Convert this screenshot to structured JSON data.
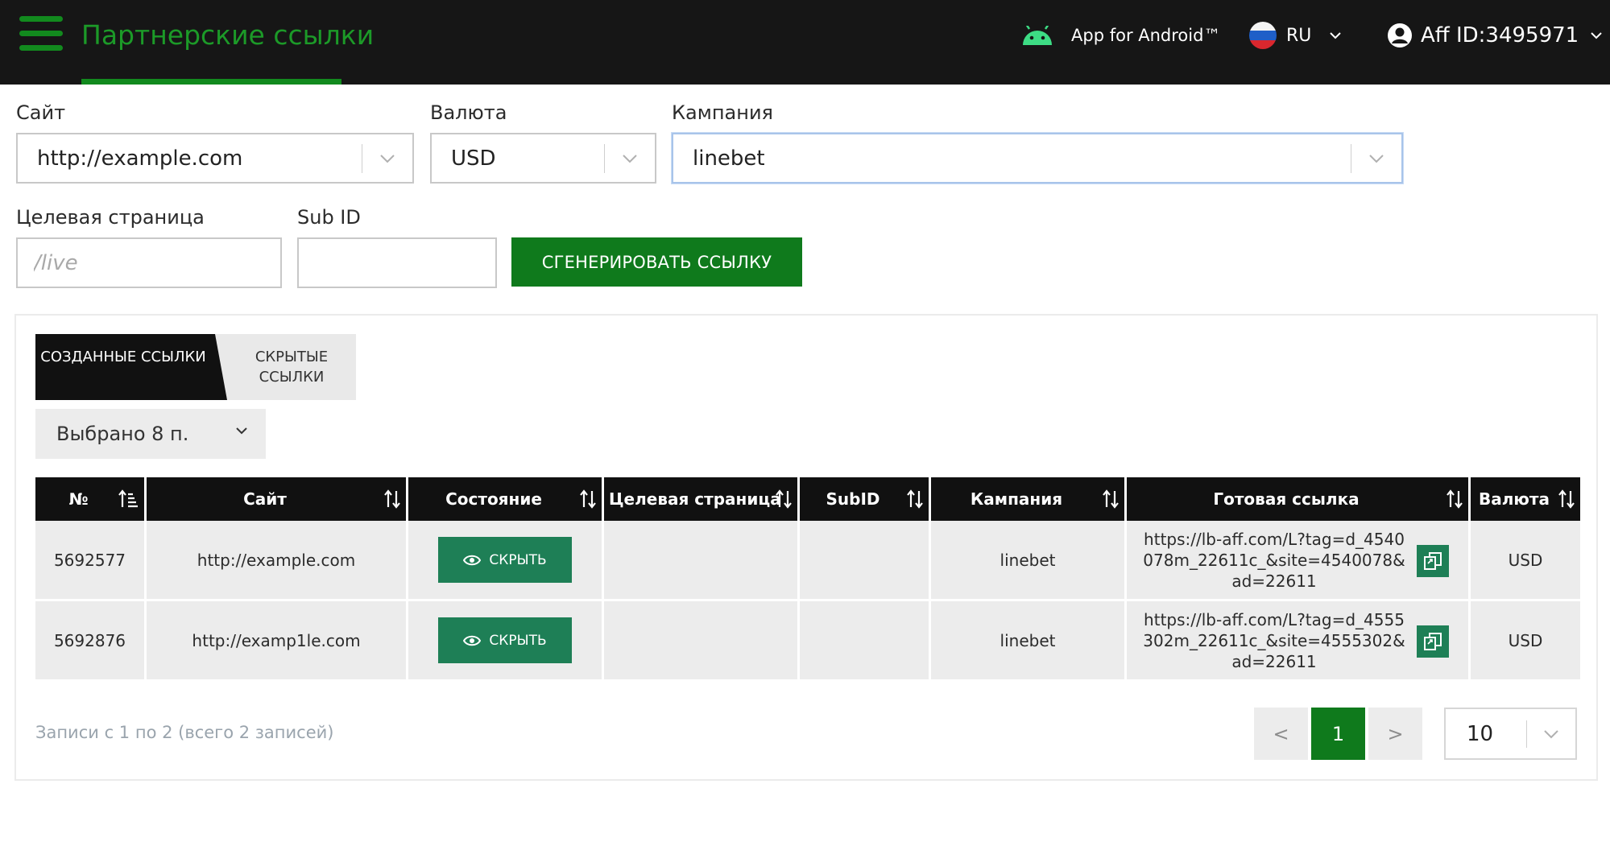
{
  "header": {
    "title": "Партнерские ссылки",
    "android_label": "App for Android™",
    "lang": "RU",
    "aff_id": "Aff ID:3495971"
  },
  "form": {
    "site_label": "Сайт",
    "site_value": "http://example.com",
    "currency_label": "Валюта",
    "currency_value": "USD",
    "campaign_label": "Кампания",
    "campaign_value": "linebet",
    "landing_label": "Целевая страница",
    "landing_placeholder": "/live",
    "subid_label": "Sub ID",
    "subid_value": "",
    "generate_label": "СГЕНЕРИРОВАТЬ ССЫЛКУ"
  },
  "tabs": {
    "created": "СОЗДАННЫЕ ССЫЛКИ",
    "hidden": "СКРЫТЫЕ ССЫЛКИ"
  },
  "columns_select": "Выбрано 8 п.",
  "table": {
    "headers": [
      "№",
      "Сайт",
      "Состояние",
      "Целевая страница",
      "SubID",
      "Кампания",
      "Готовая ссылка",
      "Валюта"
    ],
    "rows": [
      {
        "id": "5692577",
        "site": "http://example.com",
        "state": "СКРЫТЬ",
        "landing": "",
        "subid": "",
        "campaign": "linebet",
        "link": "https://lb-aff.com/L?tag=d_4540078m_22611c_&site=4540078&ad=22611",
        "currency": "USD"
      },
      {
        "id": "5692876",
        "site": "http://examp1le.com",
        "state": "СКРЫТЬ",
        "landing": "",
        "subid": "",
        "campaign": "linebet",
        "link": "https://lb-aff.com/L?tag=d_4555302m_22611c_&site=4555302&ad=22611",
        "currency": "USD"
      }
    ]
  },
  "footer": {
    "records_text": "Записи с 1 по 2 (всего 2 записей)",
    "prev": "<",
    "current_page": "1",
    "next": ">",
    "per_page": "10"
  },
  "colors": {
    "topbar": "#161616",
    "accent_green": "#0f7a1c",
    "action_green": "#1e7f56",
    "title_green": "#1c9a28"
  },
  "icons": [
    "menu-icon",
    "android-icon",
    "russia-flag-icon",
    "user-icon",
    "chevron-down-icon",
    "sort-icon",
    "eye-icon",
    "copy-icon"
  ]
}
